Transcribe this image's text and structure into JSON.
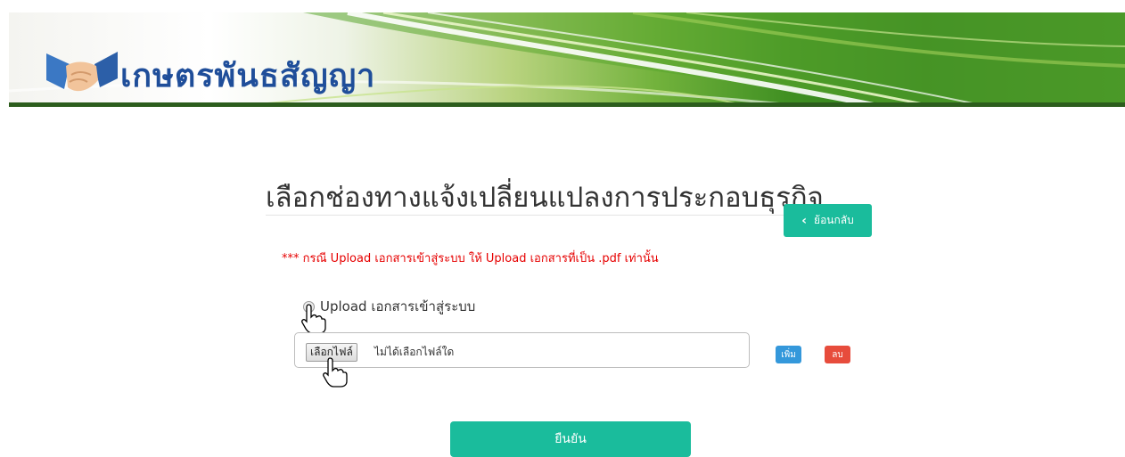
{
  "header": {
    "site_name": "เกษตรพันธสัญญา",
    "logo_icon": "handshake-icon",
    "accent_color": "#2f7d1c",
    "text_color": "#1f4e9a"
  },
  "main": {
    "title": "เลือกช่องทางแจ้งเปลี่ยนแปลงการประกอบธุรกิจ",
    "back_button_label": "ย้อนกลับ",
    "notice": "*** กรณี Upload เอกสารเข้าสู่ระบบ ให้ Upload เอกสารที่เป็น .pdf เท่านั้น",
    "upload_option_label": "Upload เอกสารเข้าสู่ระบบ",
    "file_input": {
      "button_label": "เลือกไฟล์",
      "status_text": "ไม่ได้เลือกไฟล์ใด"
    },
    "add_button_label": "เพิ่ม",
    "delete_button_label": "ลบ",
    "confirm_button_label": "ยืนยัน"
  },
  "colors": {
    "primary": "#1abc9c",
    "info": "#3498db",
    "danger": "#e74c3c",
    "notice_text": "#e60000"
  }
}
